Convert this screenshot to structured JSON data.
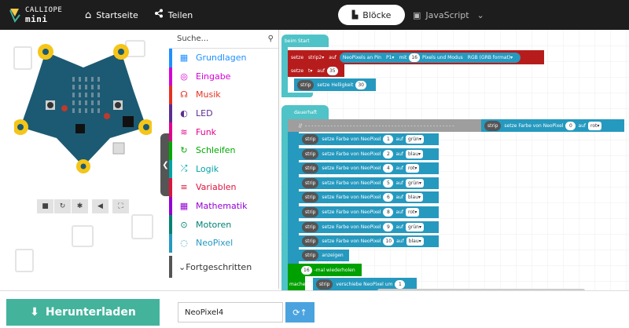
{
  "header": {
    "logo_small": "CALLIOPE",
    "logo_big": "mini",
    "home_label": "Startseite",
    "share_label": "Teilen",
    "blocks_label": "Blöcke",
    "js_label": "JavaScript"
  },
  "toolbox": {
    "search_placeholder": "Suche...",
    "categories": [
      {
        "label": "Grundlagen",
        "color": "#1e90ff",
        "icon": "grid-icon"
      },
      {
        "label": "Eingabe",
        "color": "#d400d4",
        "icon": "target-icon"
      },
      {
        "label": "Musik",
        "color": "#e63022",
        "icon": "headphones-icon"
      },
      {
        "label": "LED",
        "color": "#5c2d91",
        "icon": "toggle-icon"
      },
      {
        "label": "Funk",
        "color": "#e3008c",
        "icon": "signal-icon"
      },
      {
        "label": "Schleifen",
        "color": "#00aa00",
        "icon": "refresh-icon"
      },
      {
        "label": "Logik",
        "color": "#00a4a6",
        "icon": "shuffle-icon"
      },
      {
        "label": "Variablen",
        "color": "#dc143c",
        "icon": "lines-icon"
      },
      {
        "label": "Mathematik",
        "color": "#9400d3",
        "icon": "calculator-icon"
      },
      {
        "label": "Motoren",
        "color": "#008272",
        "icon": "car-icon"
      },
      {
        "label": "NeoPixel",
        "color": "#2699bf",
        "icon": "ring-icon"
      }
    ],
    "advanced_label": "Fortgeschritten"
  },
  "workspace": {
    "on_start": {
      "hat": "beim Start",
      "set_strip_label": "setze",
      "strip_var": "strip2",
      "to": "auf",
      "neopixel_call": "NeoPixels an Pin",
      "pin": "P1",
      "with": "mit",
      "count": "16",
      "pixels_mode": "Pixels und Modus",
      "mode": "RGB (GRB format)",
      "set_t_label": "setze",
      "t_var": "t",
      "t_value": "35",
      "strip_pill": "strip",
      "brightness": "setze Helligkeit",
      "brightness_value": "30"
    },
    "forever": {
      "hat": "dauerhaft",
      "comment_prefix": "//",
      "comment_dashes": "- - - - - - - - - - - - - - - - - - - - - - - - - - - - - - - - - - - - - - - - - - - - - - -",
      "strip_pill": "strip",
      "set_color": "setze Farbe von NeoPixel",
      "to": "auf",
      "first_index": "0",
      "first_color": "rot",
      "pixel_rows": [
        {
          "index": "1",
          "color": "grün"
        },
        {
          "index": "2",
          "color": "blau"
        },
        {
          "index": "4",
          "color": "rot"
        },
        {
          "index": "5",
          "color": "grün"
        },
        {
          "index": "6",
          "color": "blau"
        },
        {
          "index": "8",
          "color": "rot"
        },
        {
          "index": "9",
          "color": "grün"
        },
        {
          "index": "10",
          "color": "blau"
        }
      ],
      "show": "anzeigen",
      "repeat_count": "16",
      "repeat_label": "-mal wiederholen",
      "do_label": "mache",
      "shift_label": "verschiebe NeoPixel um",
      "shift_value": "1"
    }
  },
  "footer": {
    "download_label": "Herunterladen",
    "project_name": "NeoPixel4"
  }
}
